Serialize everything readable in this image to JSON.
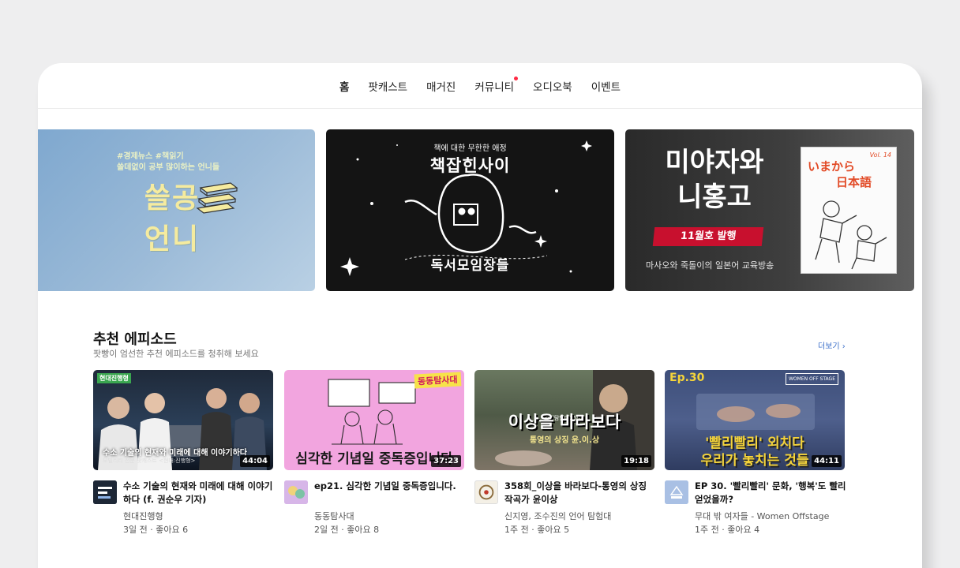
{
  "nav": {
    "items": [
      {
        "label": "홈",
        "active": true
      },
      {
        "label": "팟캐스트",
        "active": false
      },
      {
        "label": "매거진",
        "active": false
      },
      {
        "label": "커뮤니티",
        "active": false,
        "badge": true
      },
      {
        "label": "오디오북",
        "active": false
      },
      {
        "label": "이벤트",
        "active": false
      }
    ]
  },
  "banners": [
    {
      "hashtags": "#경제뉴스 #책읽기",
      "tagline": "쓸데없이 공부 많이하는 언니들",
      "title_line1": "쓸공",
      "title_line2": "언니",
      "icon": "books-icon"
    },
    {
      "tagline": "책에 대한 무한한 애정",
      "title": "책잡힌사이",
      "subtitle": "독서모임장들",
      "icon": "stars-icon"
    },
    {
      "title_line1": "미야자와",
      "title_line2": "니홍고",
      "ribbon": "11월호 발행",
      "caption": "마사오와 죽돌이의 일본어 교육방송",
      "book_vol": "Vol. 14",
      "book_title_line1": "いまから",
      "book_title_line2": "日本語"
    }
  ],
  "section": {
    "title": "추천 에피소드",
    "subtitle": "팟빵이 엄선한 추천 에피소드를 청취해 보세요",
    "more_label": "더보기 ›"
  },
  "episodes": [
    {
      "duration": "44:04",
      "title": "수소 기술의 현재와 미래에 대해 이야기하다 (f. 권순우 기자)",
      "channel": "현대진행형",
      "meta": "3일 전 · 좋아요 6",
      "thumb_tag": "현대진행형",
      "thumb_caption": "수소 기술의 현재와 미래에 대해 이야기하다",
      "thumb_small": "모빌리티 전문 팟캐스트 <현대:진행형>"
    },
    {
      "duration": "37:23",
      "title": "ep21. 심각한 기념일 중독증입니다.",
      "channel": "동동탐사대",
      "meta": "2일 전 · 좋아요 8",
      "thumb_banner": "동동탐사대",
      "thumb_caption": "심각한 기념일 중독증입니다"
    },
    {
      "duration": "19:18",
      "title": "358회_이상을 바라보다-통영의 상징 작곡가 윤이상",
      "channel": "신지영, 조수진의 언어 탐험대",
      "meta": "1주 전 · 좋아요 5",
      "thumb_top": "언어탐험대358회",
      "thumb_caption": "이상을 바라보다",
      "thumb_sub": "통영의 상징 윤.이.상"
    },
    {
      "duration": "44:11",
      "title": "EP 30. '빨리빨리' 문화, '행복'도 빨리 얻었을까?",
      "channel": "무대 밖 여자들 - Women Offstage",
      "meta": "1주 전 · 좋아요 4",
      "thumb_ep": "Ep.30",
      "thumb_cap1": "'빨리빨리' 외치다",
      "thumb_cap2": "우리가 놓치는 것들",
      "thumb_logo": "WOMEN OFF STAGE"
    }
  ],
  "colors": {
    "accent_dot": "#ff2a44",
    "link": "#3a6ec9",
    "background": "#eeeeef"
  }
}
